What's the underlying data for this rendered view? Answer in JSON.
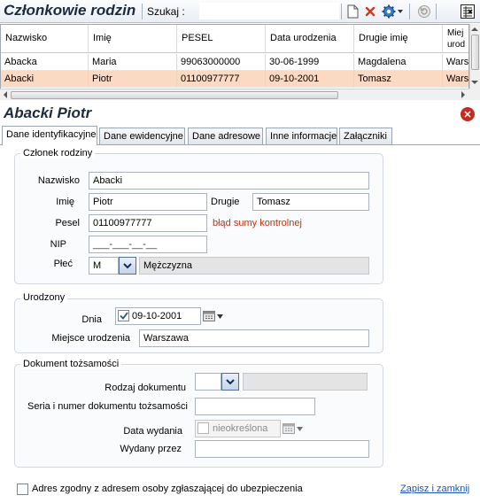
{
  "toolbar": {
    "title": "Członkowie rodzin",
    "search_label": "Szukaj  :",
    "search_value": ""
  },
  "grid": {
    "headers": [
      "Nazwisko",
      "Imię",
      "PESEL",
      "Data urodzenia",
      "Drugie imię",
      "Miej urod"
    ],
    "rows": [
      [
        "Abacka",
        "Maria",
        "99063000000",
        "30-06-1999",
        "Magdalena",
        "Wars"
      ],
      [
        "Abacki",
        "Piotr",
        "01100977777",
        "09-10-2001",
        "Tomasz",
        "Wars"
      ]
    ]
  },
  "detail": {
    "name": "Abacki Piotr"
  },
  "tabs": [
    "Dane identyfikacyjne",
    "Dane ewidencyjne",
    "Dane adresowe",
    "Inne informacje",
    "Załączniki"
  ],
  "member": {
    "group_title": "Członek rodziny",
    "surname_label": "Nazwisko",
    "surname": "Abacki",
    "firstname_label": "Imię",
    "firstname": "Piotr",
    "second_label": "Drugie",
    "second": "Tomasz",
    "pesel_label": "Pesel",
    "pesel": "01100977777",
    "pesel_error": "błąd sumy kontrolnej",
    "nip_label": "NIP",
    "nip": "___-___-__-__",
    "sex_label": "Płeć",
    "sex_code": "M",
    "sex_name": "Mężczyzna"
  },
  "born": {
    "group_title": "Urodzony",
    "date_label": "Dnia",
    "date": "09-10-2001",
    "place_label": "Miejsce urodzenia",
    "place": "Warszawa"
  },
  "document": {
    "group_title": "Dokument tożsamości",
    "type_label": "Rodzaj dokumentu",
    "number_label": "Seria i numer dokumentu tożsamości",
    "issued_label": "Data wydania",
    "issued_value": "nieokreślona",
    "issuer_label": "Wydany przez"
  },
  "footer": {
    "address_checkbox_label": "Adres zgodny z adresem osoby zgłaszającej do ubezpieczenia",
    "save_link": "Zapisz i zamknij"
  },
  "colors": {
    "selected_row": "#fcd9c2",
    "error_text": "#c5300c",
    "close_button": "#c62b1f",
    "link": "#1a56b8"
  }
}
